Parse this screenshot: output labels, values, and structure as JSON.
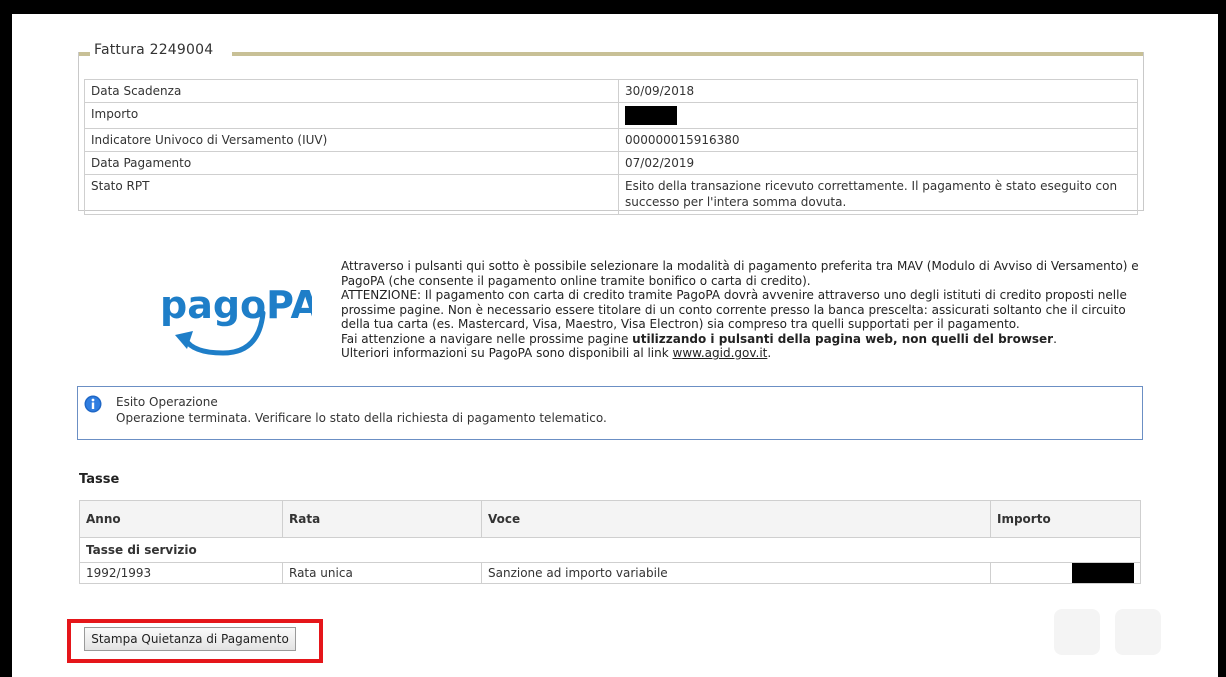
{
  "invoice": {
    "legend": "Fattura 2249004",
    "rows": [
      {
        "label": "Data Scadenza",
        "value": "30/09/2018"
      },
      {
        "label": "Importo",
        "value": ""
      },
      {
        "label": "Indicatore Univoco di Versamento (IUV)",
        "value": "000000015916380"
      },
      {
        "label": "Data Pagamento",
        "value": "07/02/2019"
      },
      {
        "label": "Stato RPT",
        "value": "Esito della transazione ricevuto correttamente. Il pagamento è stato eseguito con successo per l'intera somma dovuta."
      }
    ]
  },
  "pagopa": {
    "logo_text": "pagoPA",
    "paragraph1": "Attraverso i pulsanti qui sotto è possibile selezionare la modalità di pagamento preferita tra MAV (Modulo di Avviso di Versamento) e PagoPA (che consente il pagamento online tramite bonifico o carta di credito).",
    "paragraph2": "ATTENZIONE: Il pagamento con carta di credito tramite PagoPA dovrà avvenire attraverso uno degli istituti di credito proposti nelle prossime pagine. Non è necessario essere titolare di un conto corrente presso la banca prescelta: assicurati soltanto che il circuito della tua carta (es. Mastercard, Visa, Maestro, Visa Electron) sia compreso tra quelli supportati per il pagamento.",
    "paragraph3_pre": "Fai attenzione a navigare nelle prossime pagine ",
    "paragraph3_bold": "utilizzando i pulsanti della pagina web, non quelli del browser",
    "paragraph3_post": ".",
    "paragraph4_pre": "Ulteriori informazioni su PagoPA sono disponibili al link ",
    "link_text": "www.agid.gov.it",
    "paragraph4_post": "."
  },
  "esito": {
    "title": "Esito Operazione",
    "message": "Operazione terminata. Verificare lo stato della richiesta di pagamento telematico."
  },
  "tasse": {
    "title": "Tasse",
    "headers": {
      "anno": "Anno",
      "rata": "Rata",
      "voce": "Voce",
      "importo": "Importo"
    },
    "group_label": "Tasse di servizio",
    "row": {
      "anno": "1992/1993",
      "rata": "Rata unica",
      "voce": "Sanzione ad importo variabile",
      "importo": ""
    }
  },
  "stampa_button_label": "Stampa Quietanza di Pagamento",
  "colors": {
    "highlight": "#e5161a",
    "legend_rule": "#c8c096",
    "pagopa_blue": "#1e7ec8",
    "info_icon": "#1f67c6"
  }
}
